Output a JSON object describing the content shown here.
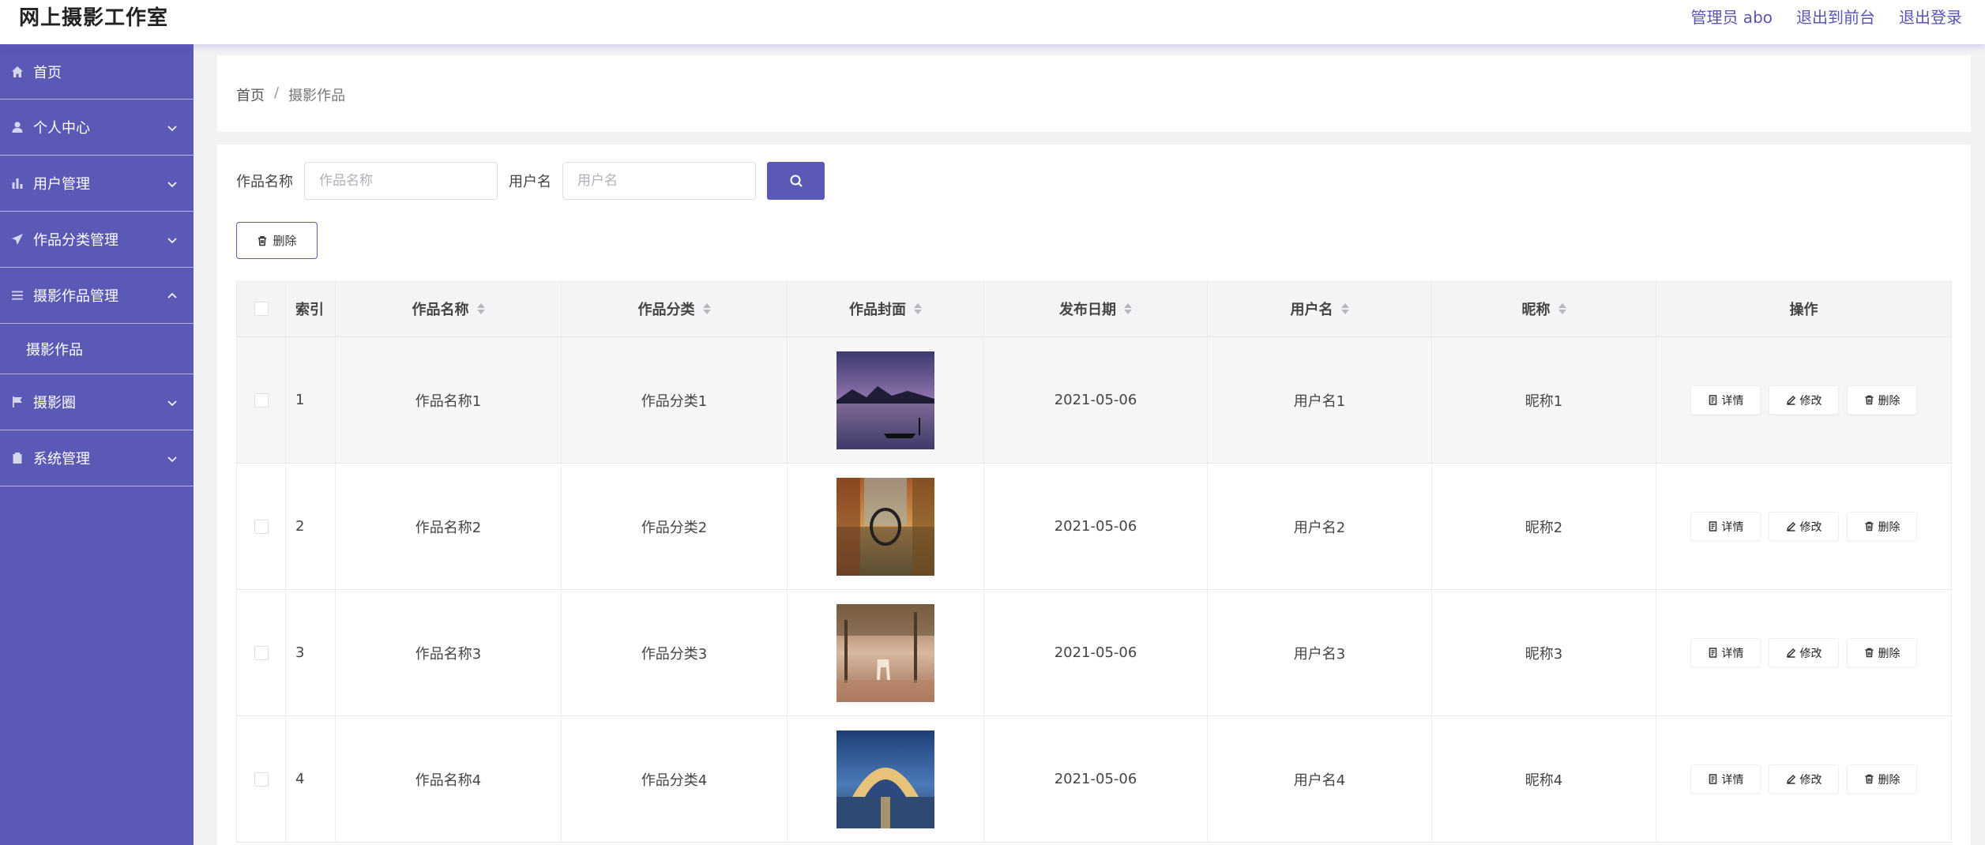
{
  "app": {
    "title": "网上摄影工作室"
  },
  "header": {
    "admin_label": "管理员 abo",
    "front_label": "退出到前台",
    "logout_label": "退出登录"
  },
  "sidebar": {
    "items": [
      {
        "label": "首页",
        "icon": "home-icon"
      },
      {
        "label": "个人中心",
        "icon": "user-icon"
      },
      {
        "label": "用户管理",
        "icon": "bar-chart-icon"
      },
      {
        "label": "作品分类管理",
        "icon": "send-icon"
      },
      {
        "label": "摄影作品管理",
        "icon": "menu-icon",
        "expanded": true
      },
      {
        "label": "摄影圈",
        "icon": "flag-icon"
      },
      {
        "label": "系统管理",
        "icon": "clipboard-icon"
      }
    ],
    "sub_item": "摄影作品"
  },
  "breadcrumb": {
    "home": "首页",
    "separator": "/",
    "current": "摄影作品"
  },
  "search": {
    "name_label": "作品名称",
    "name_placeholder": "作品名称",
    "user_label": "用户名",
    "user_placeholder": "用户名"
  },
  "toolbar": {
    "delete_label": "删除"
  },
  "table": {
    "headers": [
      "索引",
      "作品名称",
      "作品分类",
      "作品封面",
      "发布日期",
      "用户名",
      "昵称",
      "操作"
    ],
    "rows": [
      {
        "index": "1",
        "name": "作品名称1",
        "category": "作品分类1",
        "date": "2021-05-06",
        "user": "用户名1",
        "nickname": "昵称1"
      },
      {
        "index": "2",
        "name": "作品名称2",
        "category": "作品分类2",
        "date": "2021-05-06",
        "user": "用户名2",
        "nickname": "昵称2"
      },
      {
        "index": "3",
        "name": "作品名称3",
        "category": "作品分类3",
        "date": "2021-05-06",
        "user": "用户名3",
        "nickname": "昵称3"
      },
      {
        "index": "4",
        "name": "作品名称4",
        "category": "作品分类4",
        "date": "2021-05-06",
        "user": "用户名4",
        "nickname": "昵称4"
      }
    ],
    "actions": {
      "detail": "详情",
      "edit": "修改",
      "delete": "删除"
    }
  },
  "colors": {
    "accent": "#5a59b6",
    "link": "#5a55b5",
    "sidebar": "#5a59b6"
  }
}
